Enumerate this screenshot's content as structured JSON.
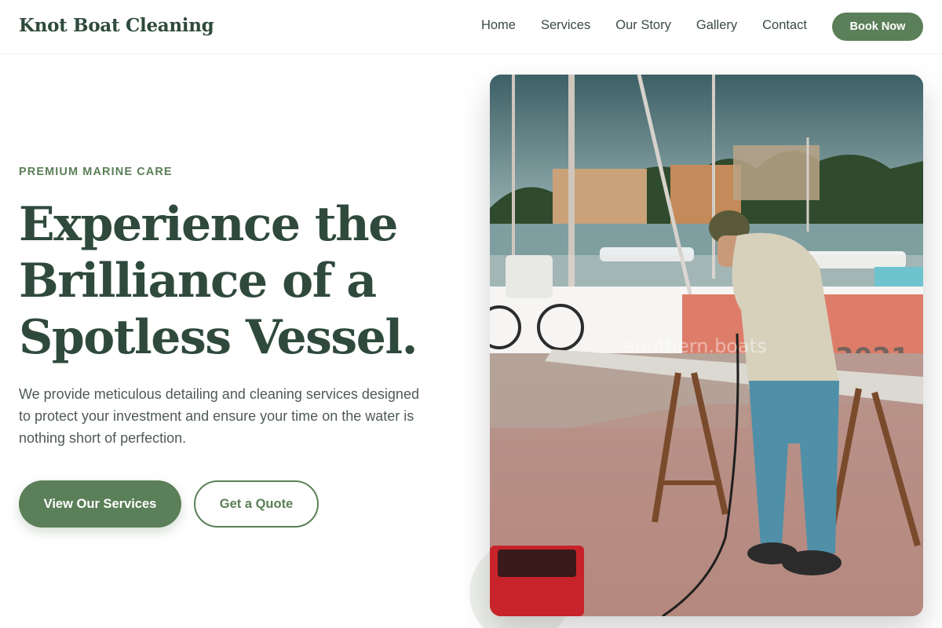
{
  "header": {
    "brand": "Knot Boat Cleaning",
    "nav": [
      "Home",
      "Services",
      "Our Story",
      "Gallery",
      "Contact"
    ],
    "cta": "Book Now"
  },
  "hero": {
    "eyebrow": "PREMIUM MARINE CARE",
    "headline_lines": [
      "Experience the",
      "Brilliance of a",
      "Spotless Vessel."
    ],
    "lede": "We provide meticulous detailing and cleaning services designed to protect your investment and ensure your time on the water is nothing short of perfection.",
    "primary_button": "View Our Services",
    "secondary_button": "Get a Quote"
  },
  "image": {
    "watermark": "southern.boats",
    "crate_text": "3021"
  },
  "colors": {
    "accent": "#5b7f58",
    "heading": "#2f4a3c",
    "body_text": "#4f5a55"
  }
}
